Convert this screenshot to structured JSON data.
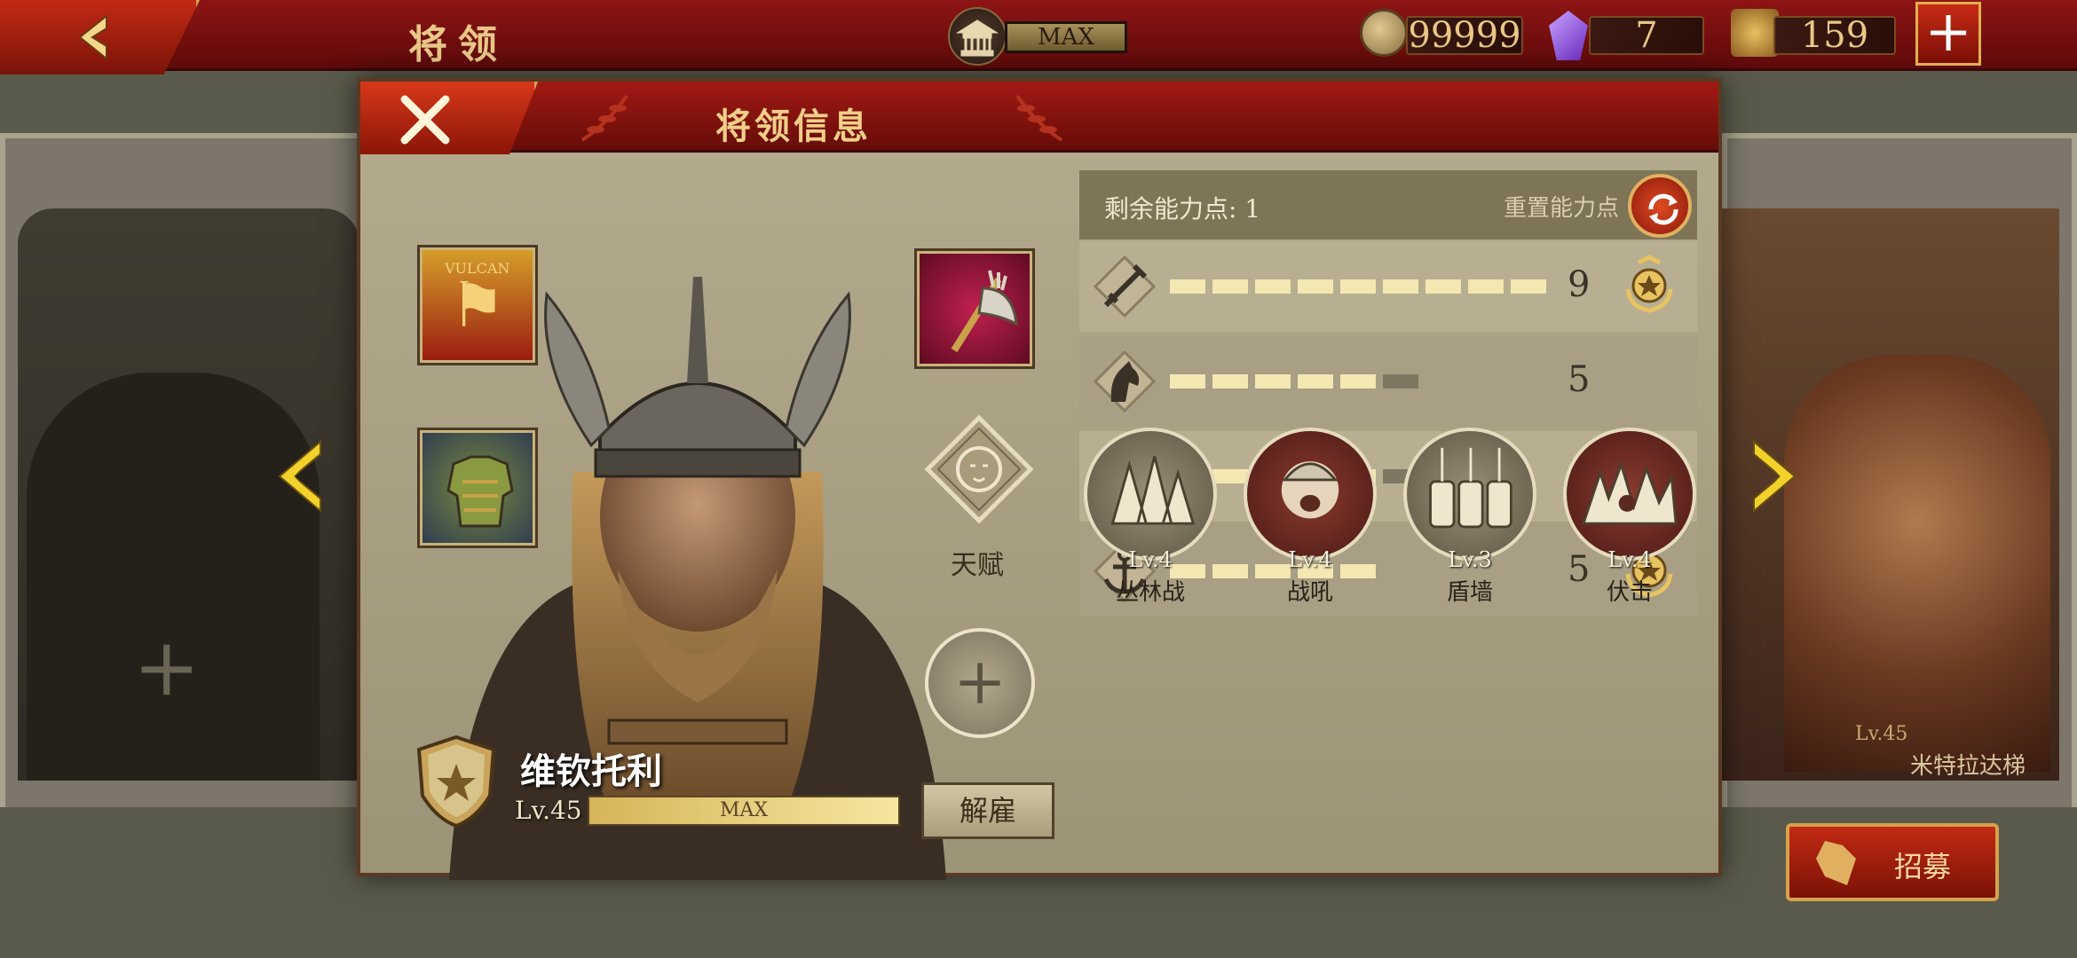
{
  "topbar": {
    "title": "将领",
    "building_level": "MAX",
    "coins": "99999",
    "gems": "7",
    "honor": "159",
    "add_label": "+"
  },
  "background": {
    "right_hero_level": "Lv.45",
    "right_hero_name": "米特拉达梯",
    "empty_slot_plus": "+",
    "recruit_label": "招募"
  },
  "dialog": {
    "title": "将领信息",
    "talent_label": "天赋",
    "add_skill_label": "+",
    "hero": {
      "name": "维钦托利",
      "level": "Lv.45",
      "xp_label": "MAX",
      "xp_fraction": 1.0
    },
    "dismiss_label": "解雇",
    "points_label": "剩余能力点: 1",
    "reset_label": "重置能力点",
    "stats": [
      {
        "icon": "sword-icon",
        "value": "9",
        "filled": 9,
        "total": 9,
        "badge": true
      },
      {
        "icon": "horse-icon",
        "value": "5",
        "filled": 5,
        "total": 6,
        "badge": false
      },
      {
        "icon": "bow-icon",
        "value": "5",
        "filled": 5,
        "total": 6,
        "badge": false
      },
      {
        "icon": "anchor-icon",
        "value": "5",
        "filled": 5,
        "total": 5,
        "badge": true
      }
    ],
    "skills": [
      {
        "icon": "forest-icon",
        "level": "Lv.4",
        "name": "丛林战"
      },
      {
        "icon": "warcry-icon",
        "level": "Lv.4",
        "name": "战吼"
      },
      {
        "icon": "shieldwall-icon",
        "level": "Lv.3",
        "name": "盾墙"
      },
      {
        "icon": "ambush-icon",
        "level": "Lv.4",
        "name": "伏击"
      }
    ],
    "equipment": {
      "banner_text": "VULCAN"
    }
  },
  "colors": {
    "header_red": "#8e1414",
    "gold": "#e8c787",
    "parchment": "#b5ab8e"
  }
}
